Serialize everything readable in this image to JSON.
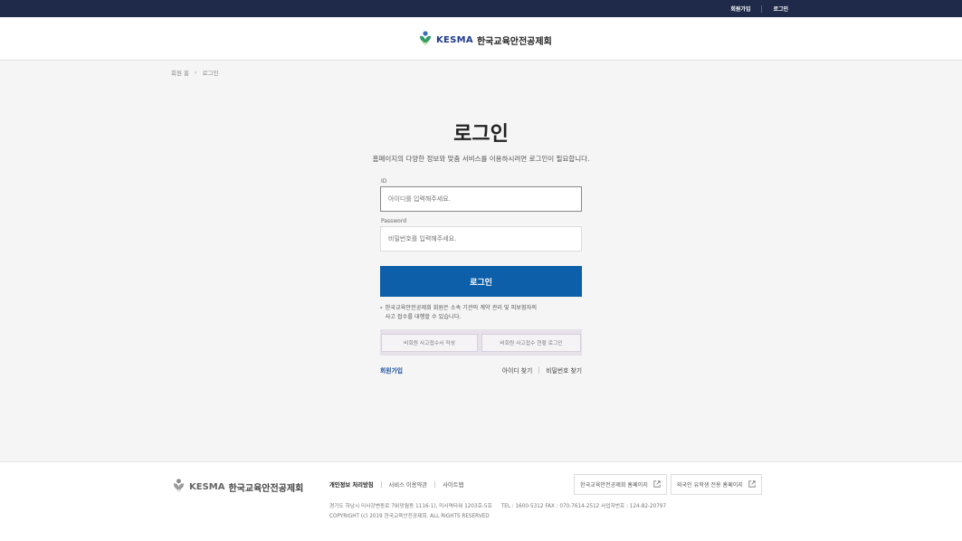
{
  "topbar": {
    "signup": "회원가입",
    "login": "로그인"
  },
  "header": {
    "brand_short": "KESMA",
    "brand_name": "한국교육안전공제회"
  },
  "breadcrumb": {
    "home": "회원 홈",
    "separator": "›",
    "current": "로그인"
  },
  "page": {
    "title": "로그인",
    "subtitle": "홈페이지의 다양한 정보와 맞춤 서비스를 이용하시려면 로그인이 필요합니다."
  },
  "form": {
    "id_label": "ID",
    "id_placeholder": "아이디를 입력해주세요.",
    "password_label": "Password",
    "password_placeholder": "비밀번호를 입력해주세요.",
    "submit_label": "로그인"
  },
  "notice": {
    "bullet": "-",
    "line1": "한국교육안전공제회 회원은 소속 기관의 계약 관리 및 피보험자의",
    "line2": "사고 접수를 대행할 수 있습니다."
  },
  "nonmember": {
    "report_button": "비회원 사고접수서 작성",
    "status_button": "비회원 사고접수 현황 로그인"
  },
  "links": {
    "join": "회원가입",
    "find_id": "아이디 찾기",
    "find_password": "비밀번호 찾기"
  },
  "footer": {
    "brand_short": "KESMA",
    "brand_name": "한국교육안전공제회",
    "menu": {
      "privacy": "개인정보 처리방침",
      "terms": "서비스 이용약관",
      "sitemap": "사이트맵"
    },
    "buttons": {
      "homepage": "한국교육안전공제회 홈페이지",
      "foreign": "외국인 유학생 전용 홈페이지"
    },
    "address": "경기도 하남시 미사강변동로 79(망월동 1116-1), 미사역타워 1203호-5호",
    "contact": "TEL : 1600-5312 FAX : 070-7614-2512 사업자번호 : 124-82-20797",
    "copyright": "COPYRIGHT (c) 2019 한국교육안전공제회. ALL RIGHTS RESERVED"
  },
  "colors": {
    "topbar": "#1f2a4a",
    "primary_button": "#0c5fa8",
    "link": "#1b4f9c"
  },
  "icons": {
    "logo": "kesma-logo-icon",
    "external_link": "external-link-icon"
  }
}
